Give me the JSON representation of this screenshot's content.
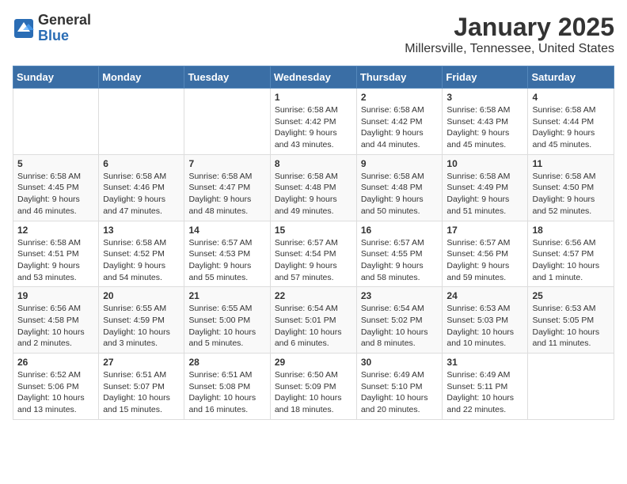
{
  "header": {
    "logo_general": "General",
    "logo_blue": "Blue",
    "month_title": "January 2025",
    "location": "Millersville, Tennessee, United States"
  },
  "days_of_week": [
    "Sunday",
    "Monday",
    "Tuesday",
    "Wednesday",
    "Thursday",
    "Friday",
    "Saturday"
  ],
  "weeks": [
    [
      {
        "day": "",
        "info": ""
      },
      {
        "day": "",
        "info": ""
      },
      {
        "day": "",
        "info": ""
      },
      {
        "day": "1",
        "info": "Sunrise: 6:58 AM\nSunset: 4:42 PM\nDaylight: 9 hours and 43 minutes."
      },
      {
        "day": "2",
        "info": "Sunrise: 6:58 AM\nSunset: 4:42 PM\nDaylight: 9 hours and 44 minutes."
      },
      {
        "day": "3",
        "info": "Sunrise: 6:58 AM\nSunset: 4:43 PM\nDaylight: 9 hours and 45 minutes."
      },
      {
        "day": "4",
        "info": "Sunrise: 6:58 AM\nSunset: 4:44 PM\nDaylight: 9 hours and 45 minutes."
      }
    ],
    [
      {
        "day": "5",
        "info": "Sunrise: 6:58 AM\nSunset: 4:45 PM\nDaylight: 9 hours and 46 minutes."
      },
      {
        "day": "6",
        "info": "Sunrise: 6:58 AM\nSunset: 4:46 PM\nDaylight: 9 hours and 47 minutes."
      },
      {
        "day": "7",
        "info": "Sunrise: 6:58 AM\nSunset: 4:47 PM\nDaylight: 9 hours and 48 minutes."
      },
      {
        "day": "8",
        "info": "Sunrise: 6:58 AM\nSunset: 4:48 PM\nDaylight: 9 hours and 49 minutes."
      },
      {
        "day": "9",
        "info": "Sunrise: 6:58 AM\nSunset: 4:48 PM\nDaylight: 9 hours and 50 minutes."
      },
      {
        "day": "10",
        "info": "Sunrise: 6:58 AM\nSunset: 4:49 PM\nDaylight: 9 hours and 51 minutes."
      },
      {
        "day": "11",
        "info": "Sunrise: 6:58 AM\nSunset: 4:50 PM\nDaylight: 9 hours and 52 minutes."
      }
    ],
    [
      {
        "day": "12",
        "info": "Sunrise: 6:58 AM\nSunset: 4:51 PM\nDaylight: 9 hours and 53 minutes."
      },
      {
        "day": "13",
        "info": "Sunrise: 6:58 AM\nSunset: 4:52 PM\nDaylight: 9 hours and 54 minutes."
      },
      {
        "day": "14",
        "info": "Sunrise: 6:57 AM\nSunset: 4:53 PM\nDaylight: 9 hours and 55 minutes."
      },
      {
        "day": "15",
        "info": "Sunrise: 6:57 AM\nSunset: 4:54 PM\nDaylight: 9 hours and 57 minutes."
      },
      {
        "day": "16",
        "info": "Sunrise: 6:57 AM\nSunset: 4:55 PM\nDaylight: 9 hours and 58 minutes."
      },
      {
        "day": "17",
        "info": "Sunrise: 6:57 AM\nSunset: 4:56 PM\nDaylight: 9 hours and 59 minutes."
      },
      {
        "day": "18",
        "info": "Sunrise: 6:56 AM\nSunset: 4:57 PM\nDaylight: 10 hours and 1 minute."
      }
    ],
    [
      {
        "day": "19",
        "info": "Sunrise: 6:56 AM\nSunset: 4:58 PM\nDaylight: 10 hours and 2 minutes."
      },
      {
        "day": "20",
        "info": "Sunrise: 6:55 AM\nSunset: 4:59 PM\nDaylight: 10 hours and 3 minutes."
      },
      {
        "day": "21",
        "info": "Sunrise: 6:55 AM\nSunset: 5:00 PM\nDaylight: 10 hours and 5 minutes."
      },
      {
        "day": "22",
        "info": "Sunrise: 6:54 AM\nSunset: 5:01 PM\nDaylight: 10 hours and 6 minutes."
      },
      {
        "day": "23",
        "info": "Sunrise: 6:54 AM\nSunset: 5:02 PM\nDaylight: 10 hours and 8 minutes."
      },
      {
        "day": "24",
        "info": "Sunrise: 6:53 AM\nSunset: 5:03 PM\nDaylight: 10 hours and 10 minutes."
      },
      {
        "day": "25",
        "info": "Sunrise: 6:53 AM\nSunset: 5:05 PM\nDaylight: 10 hours and 11 minutes."
      }
    ],
    [
      {
        "day": "26",
        "info": "Sunrise: 6:52 AM\nSunset: 5:06 PM\nDaylight: 10 hours and 13 minutes."
      },
      {
        "day": "27",
        "info": "Sunrise: 6:51 AM\nSunset: 5:07 PM\nDaylight: 10 hours and 15 minutes."
      },
      {
        "day": "28",
        "info": "Sunrise: 6:51 AM\nSunset: 5:08 PM\nDaylight: 10 hours and 16 minutes."
      },
      {
        "day": "29",
        "info": "Sunrise: 6:50 AM\nSunset: 5:09 PM\nDaylight: 10 hours and 18 minutes."
      },
      {
        "day": "30",
        "info": "Sunrise: 6:49 AM\nSunset: 5:10 PM\nDaylight: 10 hours and 20 minutes."
      },
      {
        "day": "31",
        "info": "Sunrise: 6:49 AM\nSunset: 5:11 PM\nDaylight: 10 hours and 22 minutes."
      },
      {
        "day": "",
        "info": ""
      }
    ]
  ]
}
